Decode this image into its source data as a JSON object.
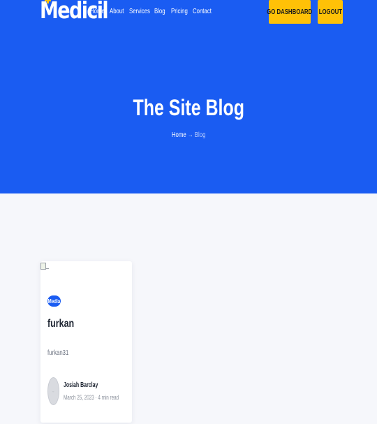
{
  "brand": {
    "name": "Medicil",
    "accent": "#ffc107",
    "primary": "#1a5cf2"
  },
  "nav": {
    "items": [
      {
        "label": "Home"
      },
      {
        "label": "About"
      },
      {
        "label": "Services"
      },
      {
        "label": "Blog"
      },
      {
        "label": "Pricing"
      },
      {
        "label": "Contact"
      }
    ],
    "dashboard_label": "GO DASHBOARD",
    "logout_label": "LOGOUT"
  },
  "hero": {
    "title": "The Site Blog",
    "breadcrumb": {
      "home": "Home",
      "separator": "→",
      "current": "Blog"
    }
  },
  "posts": [
    {
      "image_icon": "broken-image-icon",
      "category": "Media",
      "title": "furkan",
      "excerpt": "furkan31",
      "author": "Josiah Barclay",
      "date": "March 25, 2023",
      "read_time": "4 min read"
    }
  ]
}
